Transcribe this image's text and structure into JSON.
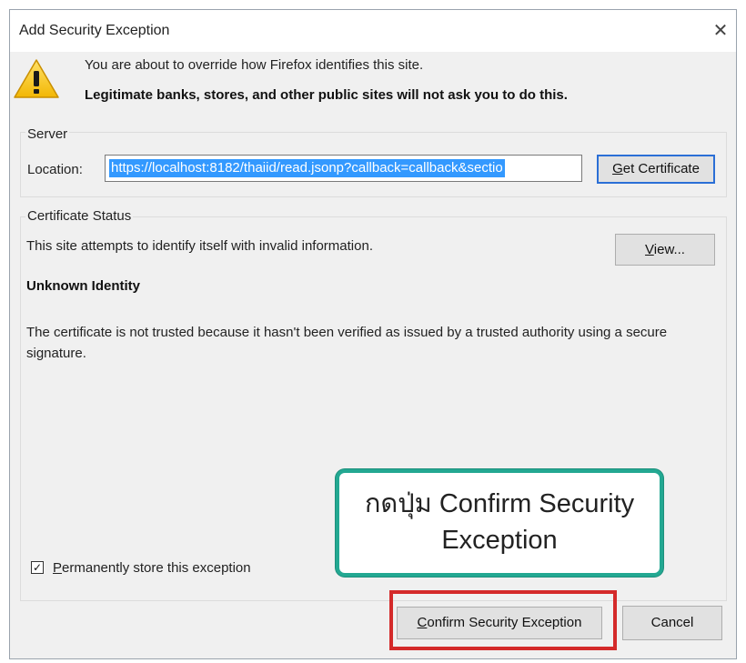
{
  "dialog": {
    "title": "Add Security Exception",
    "close_label": "✕",
    "message_line1": "You are about to override how Firefox identifies this site.",
    "message_line2": "Legitimate banks, stores, and other public sites will not ask you to do this."
  },
  "server": {
    "group_label": "Server",
    "location_label": "Location:",
    "location_value": "https://localhost:8182/thaiid/read.jsonp?callback=callback&sectio",
    "get_certificate_label_accel": "G",
    "get_certificate_label_rest": "et Certificate"
  },
  "certificate_status": {
    "group_label": "Certificate Status",
    "status_text": "This site attempts to identify itself with invalid information.",
    "view_label_accel": "V",
    "view_label_rest": "iew...",
    "heading": "Unknown Identity",
    "description": "The certificate is not trusted because it hasn't been verified as issued by a trusted authority using a secure signature."
  },
  "permanent_store": {
    "checked": true,
    "check_mark": "✓",
    "label_accel": "P",
    "label_rest": "ermanently store this exception"
  },
  "buttons": {
    "confirm_accel": "C",
    "confirm_rest": "onfirm Security Exception",
    "cancel_label": "Cancel"
  },
  "annotation": {
    "line1": "กดปุ่ม Confirm Security",
    "line2": "Exception",
    "border_color": "#23a892",
    "highlight_color": "#d42a2a"
  },
  "icons": {
    "warning": "warning-triangle-icon",
    "close": "close-icon",
    "checkbox": "checkmark-icon"
  }
}
